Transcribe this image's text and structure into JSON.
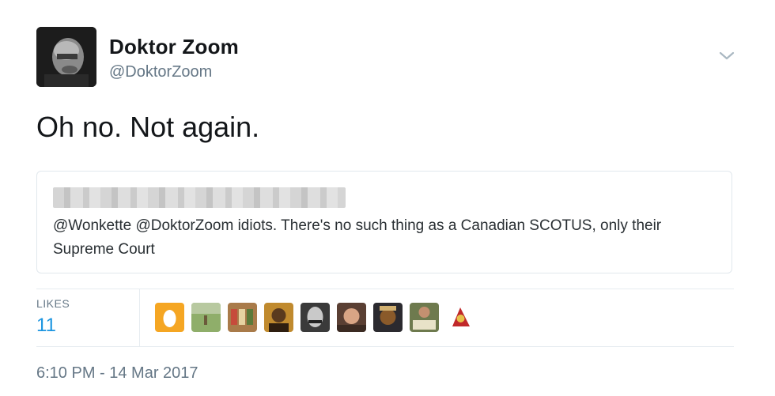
{
  "author": {
    "display_name": "Doktor Zoom",
    "handle": "@DoktorZoom"
  },
  "tweet": {
    "text": "Oh no. Not again."
  },
  "quoted_tweet": {
    "text": "@Wonkette @DoktorZoom idiots. There's no such thing as a Canadian SCOTUS, only their Supreme Court"
  },
  "stats": {
    "likes_label": "LIKES",
    "likes_count": "11"
  },
  "likers": [
    {
      "name": "liker-egg-avatar"
    },
    {
      "name": "liker-avatar-2"
    },
    {
      "name": "liker-avatar-3"
    },
    {
      "name": "liker-avatar-4"
    },
    {
      "name": "liker-avatar-5"
    },
    {
      "name": "liker-avatar-6"
    },
    {
      "name": "liker-avatar-7"
    },
    {
      "name": "liker-avatar-8"
    },
    {
      "name": "liker-avatar-9"
    }
  ],
  "footer": {
    "timestamp": "6:10 PM - 14 Mar 2017"
  },
  "icons": {
    "menu": "chevron-down-icon"
  },
  "colors": {
    "link_blue": "#1b95e0",
    "secondary_text": "#657786",
    "border": "#e1e8ed"
  }
}
